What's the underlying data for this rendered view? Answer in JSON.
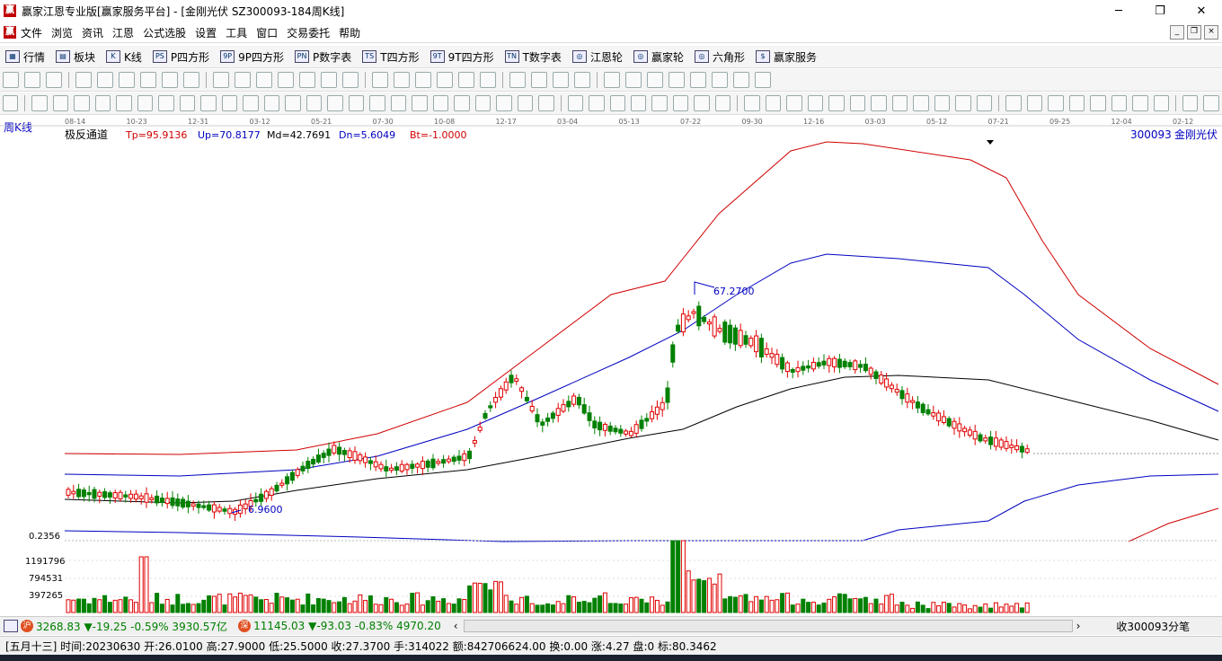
{
  "window": {
    "title": "赢家江恩专业版[赢家服务平台] - [金刚光伏  SZ300093-184周K线]",
    "logo": "赢",
    "controls": [
      "─",
      "❐",
      "✕"
    ]
  },
  "menu": {
    "logo": "赢",
    "items": [
      "文件",
      "浏览",
      "资讯",
      "江恩",
      "公式选股",
      "设置",
      "工具",
      "窗口",
      "交易委托",
      "帮助"
    ],
    "mdi": [
      "_",
      "❐",
      "×"
    ]
  },
  "toolbar1": {
    "items": [
      {
        "icon": "▦",
        "label": "行情"
      },
      {
        "icon": "▤",
        "label": "板块"
      },
      {
        "icon": "K",
        "label": "K线"
      },
      {
        "icon": "PS",
        "label": "P四方形"
      },
      {
        "icon": "9P",
        "label": "9P四方形"
      },
      {
        "icon": "PN",
        "label": "P数字表"
      },
      {
        "icon": "TS",
        "label": "T四方形"
      },
      {
        "icon": "9T",
        "label": "9T四方形"
      },
      {
        "icon": "TN",
        "label": "T数字表"
      },
      {
        "icon": "◎",
        "label": "江恩轮"
      },
      {
        "icon": "◎",
        "label": "赢家轮"
      },
      {
        "icon": "◎",
        "label": "六角形"
      },
      {
        "icon": "$",
        "label": "赢家服务"
      }
    ]
  },
  "chart": {
    "period_label": "周K线",
    "indicator_name": "极反通道",
    "params": [
      {
        "text": "Tp=95.9136",
        "color": "#d00000"
      },
      {
        "text": "Up=70.8177",
        "color": "#0000c0"
      },
      {
        "text": "Md=42.7691",
        "color": "#000000"
      },
      {
        "text": "Dn=5.6049",
        "color": "#0000c0"
      },
      {
        "text": "Bt=-1.0000",
        "color": "#d00000"
      }
    ],
    "stock_code": "300093",
    "stock_name": "金刚光伏",
    "high_label": "67.2700",
    "low_label": "6.9600",
    "date_ticks": [
      "08-14",
      "10-23",
      "12-31",
      "03-12",
      "05-21",
      "07-30",
      "10-08",
      "12-17",
      "03-04",
      "05-13",
      "07-22",
      "09-30",
      "12-16",
      "03-03",
      "05-12",
      "07-21",
      "09-25",
      "12-04",
      "02-12"
    ],
    "volume_axis": [
      "0.2356",
      "1191796",
      "794531",
      "397265"
    ]
  },
  "bottom": {
    "sh_index": "3268.83 ▼-19.25 -0.59% 3930.57亿",
    "sz_index": "11145.03 ▼-93.03 -0.83% 4970.20",
    "right_label": "收300093分笔"
  },
  "status": {
    "text": "[五月十三] 时间:20230630 开:26.0100 高:27.9000 低:25.5000 收:27.3700 手:314022 额:842706624.00 换:0.00 涨:4.27 盘:0 标:80.3462"
  },
  "colors": {
    "up": "#e00000",
    "down": "#008000",
    "top_band": "#d00000",
    "mid_band": "#000000",
    "up_band": "#0000c0"
  }
}
